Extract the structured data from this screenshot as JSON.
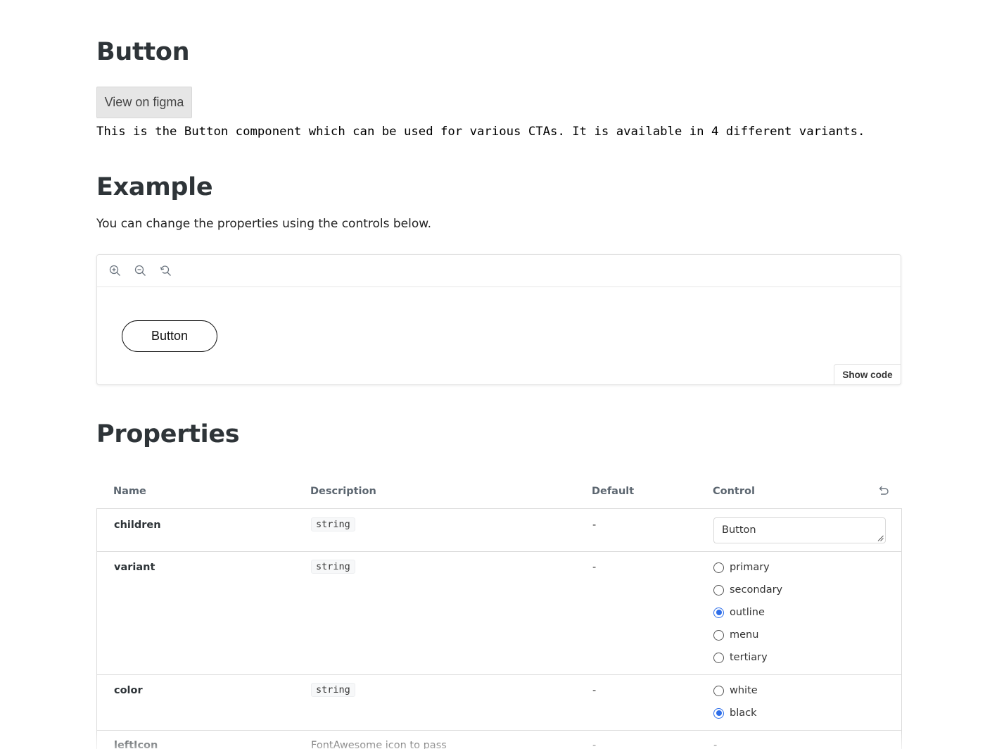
{
  "page": {
    "title": "Button",
    "figma_label": "View on figma",
    "intro": "This is the Button component which can be used for various CTAs. It is available in 4 different variants."
  },
  "example": {
    "heading": "Example",
    "lead": "You can change the properties using the controls below.",
    "toolbar": [
      "zoom-in-icon",
      "zoom-out-icon",
      "reset-zoom-icon"
    ],
    "preview_button_label": "Button",
    "show_code_label": "Show code"
  },
  "properties": {
    "heading": "Properties",
    "columns": {
      "name": "Name",
      "description": "Description",
      "default": "Default",
      "control": "Control"
    },
    "rows": [
      {
        "name": "children",
        "type": "string",
        "default": "-",
        "control": {
          "kind": "text",
          "value": "Button"
        }
      },
      {
        "name": "variant",
        "type": "string",
        "default": "-",
        "control": {
          "kind": "radio",
          "options": [
            "primary",
            "secondary",
            "outline",
            "menu",
            "tertiary"
          ],
          "selected": "outline"
        }
      },
      {
        "name": "color",
        "type": "string",
        "default": "-",
        "control": {
          "kind": "radio",
          "options": [
            "white",
            "black"
          ],
          "selected": "black"
        }
      },
      {
        "name": "leftIcon",
        "description": "FontAwesome icon to pass",
        "default": "-",
        "control": {
          "kind": "none",
          "value": "-"
        }
      }
    ]
  },
  "colors": {
    "accent": "#2f6fe9",
    "heading": "#2e3438",
    "figma_button_bg": "#e6e6e6"
  }
}
